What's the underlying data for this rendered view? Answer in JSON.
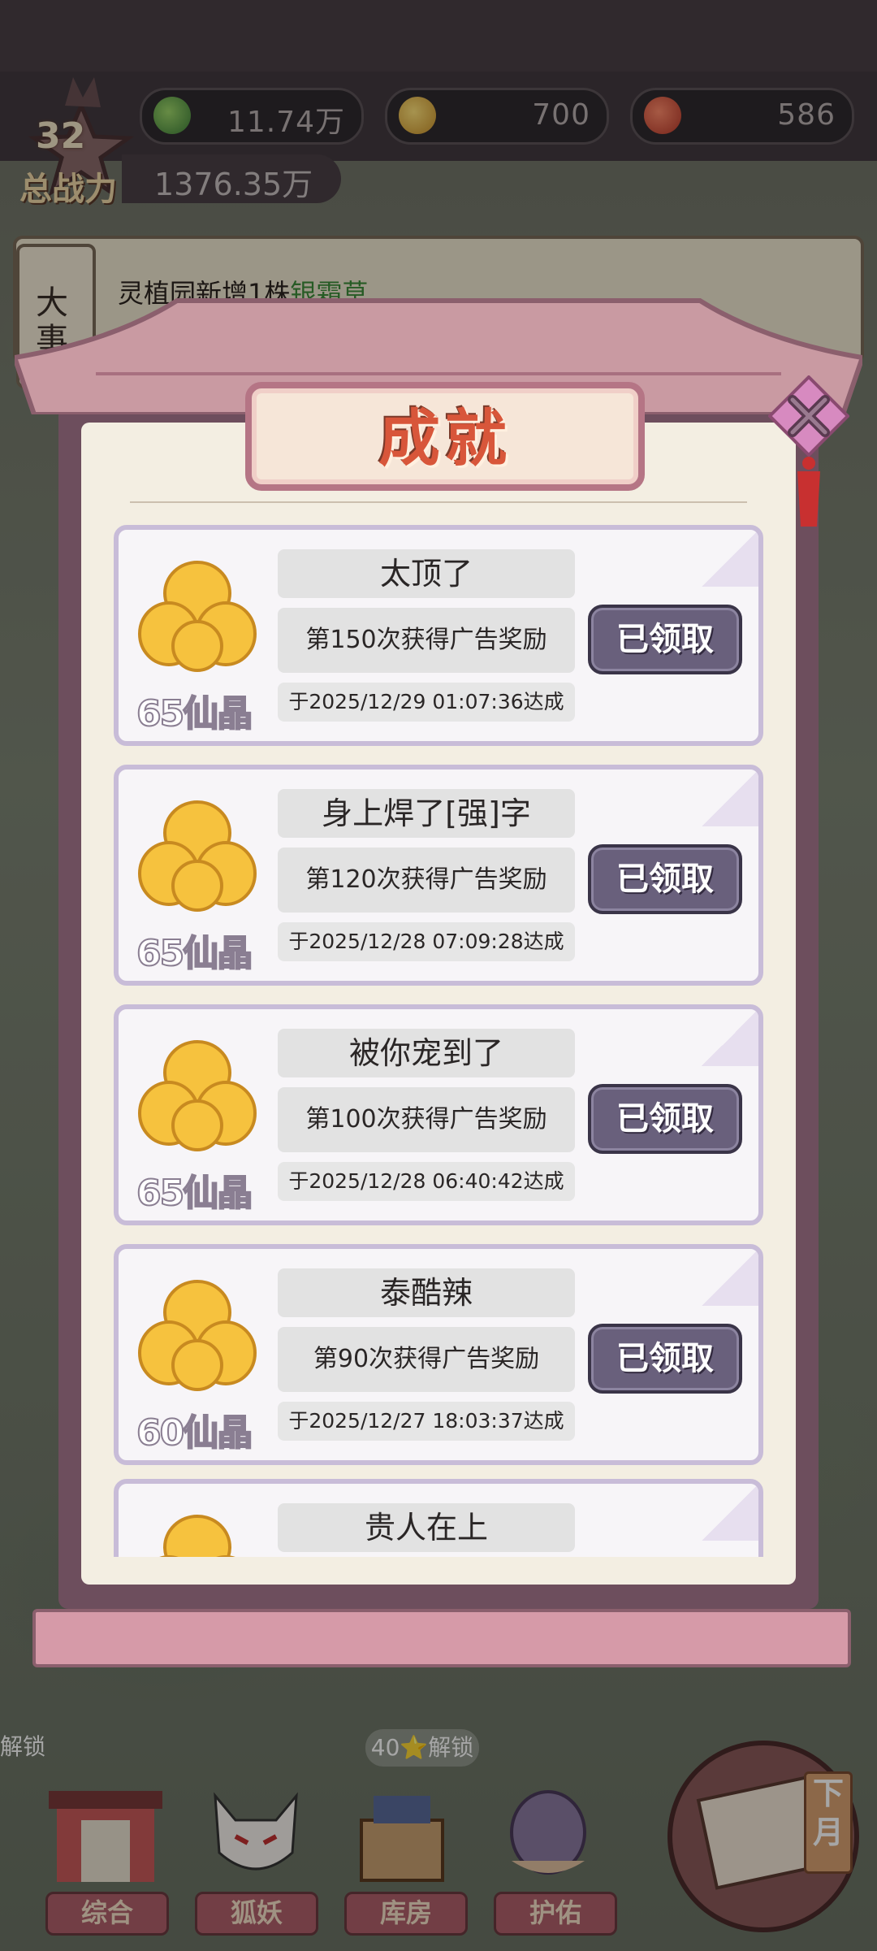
{
  "resources": [
    {
      "icon": "green-leaf-icon",
      "value": "11.74万"
    },
    {
      "icon": "gold-ingot-icon",
      "value": "700"
    },
    {
      "icon": "red-peach-icon",
      "value": "586"
    }
  ],
  "power": {
    "level": "32",
    "label": "总战力",
    "value": "1376.35万"
  },
  "event_log": {
    "tab_label": "大事",
    "lines": [
      {
        "text": "灵植园新增1株",
        "highlight": "银霜草"
      }
    ]
  },
  "dialog": {
    "title": "成就",
    "close_icon": "close-x-icon",
    "achievements": [
      {
        "name": "太顶了",
        "desc": "第150次获得广告奖励",
        "time": "于2025/12/29  01:07:36达成",
        "reward": "65仙晶",
        "button": "已领取"
      },
      {
        "name": "身上焊了[强]字",
        "desc": "第120次获得广告奖励",
        "time": "于2025/12/28  07:09:28达成",
        "reward": "65仙晶",
        "button": "已领取"
      },
      {
        "name": "被你宠到了",
        "desc": "第100次获得广告奖励",
        "time": "于2025/12/28  06:40:42达成",
        "reward": "65仙晶",
        "button": "已领取"
      },
      {
        "name": "泰酷辣",
        "desc": "第90次获得广告奖励",
        "time": "于2025/12/27  18:03:37达成",
        "reward": "60仙晶",
        "button": "已领取"
      },
      {
        "name": "贵人在上"
      }
    ]
  },
  "map": {
    "unlock_label": "40⭐解锁",
    "unlock_left": "解锁"
  },
  "nav": {
    "items": [
      "综合",
      "狐妖",
      "库房",
      "护佑"
    ],
    "next_month": "下月"
  },
  "colors": {
    "accent": "#d8563a",
    "button": "#69607c",
    "frame": "#6d4e5d"
  }
}
